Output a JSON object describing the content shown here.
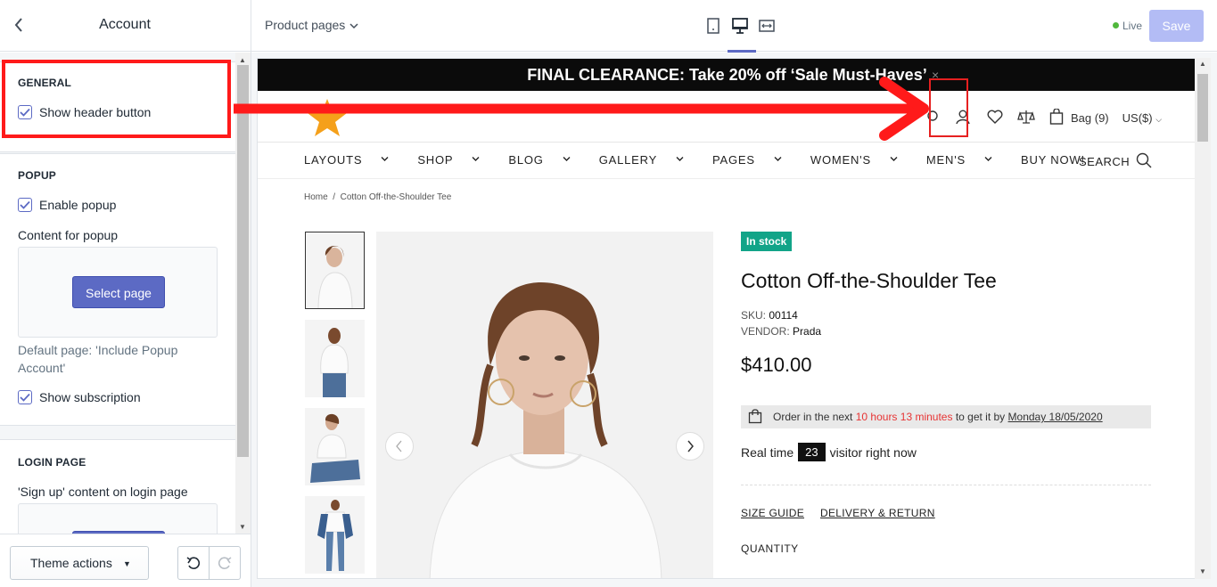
{
  "header": {
    "back_icon": "chevron-left-icon",
    "title": "Account",
    "page_selector": "Product pages",
    "devices": [
      "mobile-icon",
      "desktop-icon",
      "fullwidth-icon"
    ],
    "active_device": "desktop",
    "live_label": "Live",
    "save_label": "Save"
  },
  "sidebar": {
    "general": {
      "title": "GENERAL",
      "show_header_button": {
        "label": "Show header button",
        "checked": true
      }
    },
    "popup": {
      "title": "POPUP",
      "enable_popup": {
        "label": "Enable popup",
        "checked": true
      },
      "content_label": "Content for popup",
      "select_page_label": "Select page",
      "help": "Default page: 'Include Popup Account'",
      "show_subscription": {
        "label": "Show subscription",
        "checked": true
      }
    },
    "login": {
      "title": "LOGIN PAGE",
      "signup_label": "'Sign up' content on login page"
    }
  },
  "footer": {
    "theme_actions": "Theme actions"
  },
  "preview": {
    "announcement": "FINAL CLEARANCE: Take 20% off ‘Sale Must-Haves’",
    "announcement_close": "×",
    "header": {
      "bag": "Bag (9)",
      "currency": "US($)"
    },
    "nav": [
      "LAYOUTS",
      "SHOP",
      "BLOG",
      "GALLERY",
      "PAGES",
      "WOMEN'S",
      "MEN'S",
      "BUY NOW!"
    ],
    "nav_dropdowns": [
      true,
      true,
      true,
      true,
      true,
      true,
      true,
      false
    ],
    "search": "SEARCH",
    "breadcrumb": {
      "home": "Home",
      "sep": "/",
      "current": "Cotton Off-the-Shoulder Tee"
    },
    "product": {
      "stock": "In stock",
      "title": "Cotton Off-the-Shoulder Tee",
      "sku_label": "SKU:",
      "sku": "00114",
      "vendor_label": "VENDOR:",
      "vendor": "Prada",
      "price": "$410.00",
      "order_prefix": "Order in the next",
      "order_time": "10 hours 13 minutes",
      "order_mid": "to get it by",
      "order_date": "Monday 18/05/2020",
      "realtime_prefix": "Real time",
      "visitors": "23",
      "realtime_suffix": "visitor right now",
      "size_guide": "SIZE GUIDE",
      "delivery": "DELIVERY & RETURN",
      "quantity": "QUANTITY"
    }
  },
  "colors": {
    "accent": "#5c6ac4",
    "annotation": "#ff1a1a",
    "stock": "#12a488",
    "save_disabled": "#b3bcf5"
  }
}
